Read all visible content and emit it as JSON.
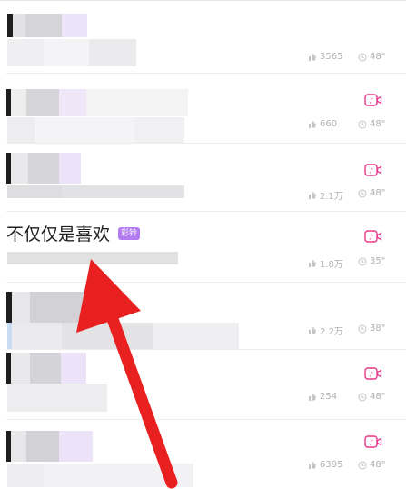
{
  "colors": {
    "accent": "#e8388a",
    "badge": "#b27bf0",
    "arrow": "#e8201f",
    "muted": "#b0b0b0"
  },
  "items": [
    {
      "likes": "3565",
      "duration": "48\"",
      "has_video_icon": false
    },
    {
      "likes": "660",
      "duration": "48\"",
      "has_video_icon": true
    },
    {
      "likes": "2.1万",
      "duration": "48\"",
      "has_video_icon": true
    },
    {
      "title": "不仅仅是喜欢",
      "badge": "彩铃",
      "likes": "1.8万",
      "duration": "35\"",
      "has_video_icon": true
    },
    {
      "likes": "2.2万",
      "duration": "38\"",
      "has_video_icon": false
    },
    {
      "likes": "254",
      "duration": "48\"",
      "has_video_icon": true
    },
    {
      "likes": "6395",
      "duration": "48\"",
      "has_video_icon": true
    }
  ],
  "annotation": {
    "icon": "red-arrow-icon"
  }
}
